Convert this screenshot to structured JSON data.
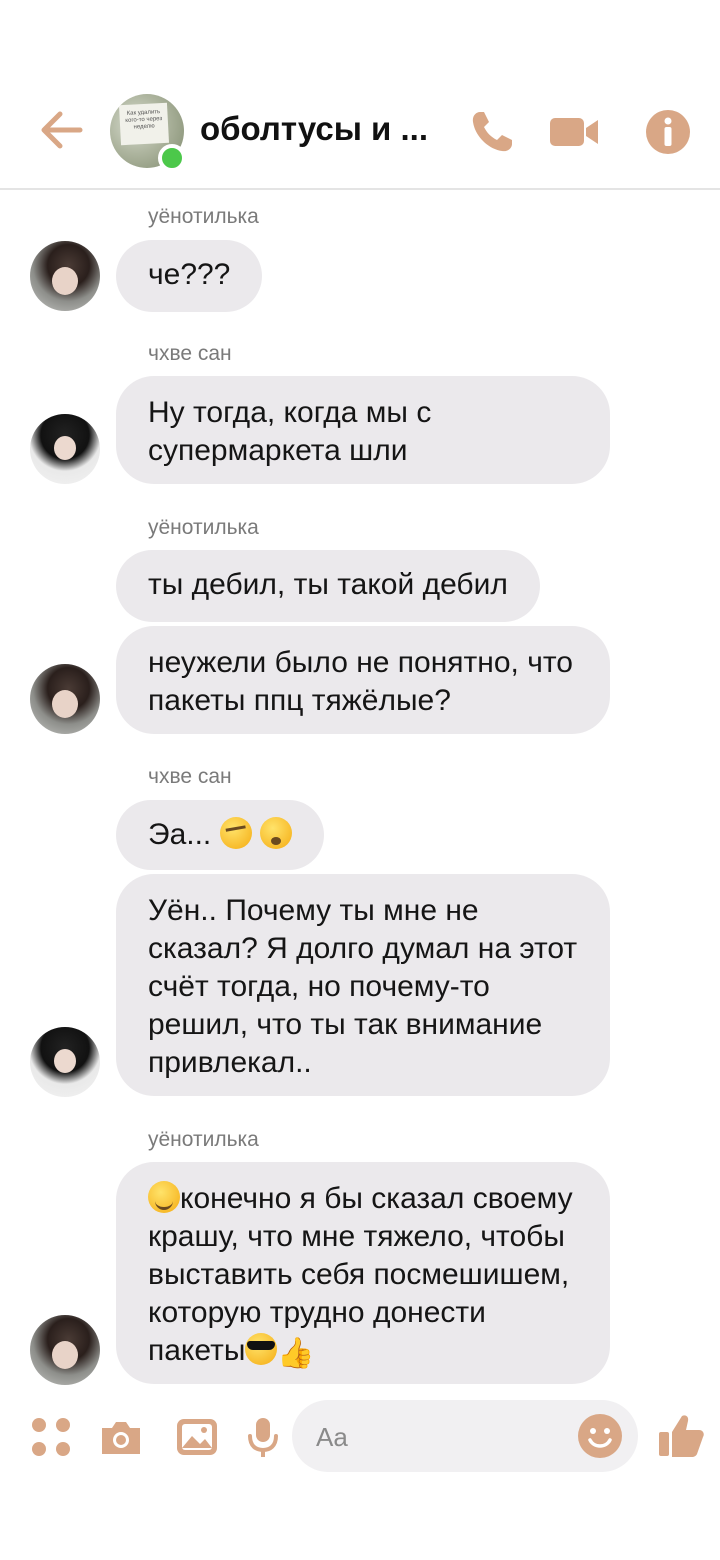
{
  "header": {
    "title": "оболтусы и ...",
    "avatar_note": "Как удалить кого-то через неделю",
    "accent": "#d9a786",
    "icons": [
      "back-arrow-icon",
      "phone-icon",
      "video-camera-icon",
      "info-icon"
    ]
  },
  "messages": {
    "g1": {
      "sender": "уёнотилька",
      "b1": "че???"
    },
    "g2": {
      "sender": "чхве сан",
      "b1": "Ну тогда, когда мы с супермаркета шли"
    },
    "g3": {
      "sender": "уёнотилька",
      "b1": "ты дебил, ты такой дебил",
      "b2": "неужели было не понятно, что пакеты ппц тяжёлые?"
    },
    "g4": {
      "sender": "чхве сан",
      "b1": "Эа... ",
      "b2": "Уён.. Почему ты мне не сказал? Я долго думал на этот счёт тогда, но почему-то решил, что ты так внимание привлекал.."
    },
    "g5": {
      "sender": "уёнотилька",
      "b1": "конечно я бы сказал своему крашу, что мне тяжело, чтобы выставить себя посмешишем, которую трудно донести пакеты"
    }
  },
  "composer": {
    "placeholder": "Aa",
    "icons": [
      "apps-icon",
      "camera-icon",
      "gallery-icon",
      "microphone-icon",
      "emoji-icon",
      "thumbs-up-icon"
    ]
  },
  "colors": {
    "bubble": "#ebe9ec",
    "online": "#4cc84a",
    "accent": "#d9a786"
  }
}
